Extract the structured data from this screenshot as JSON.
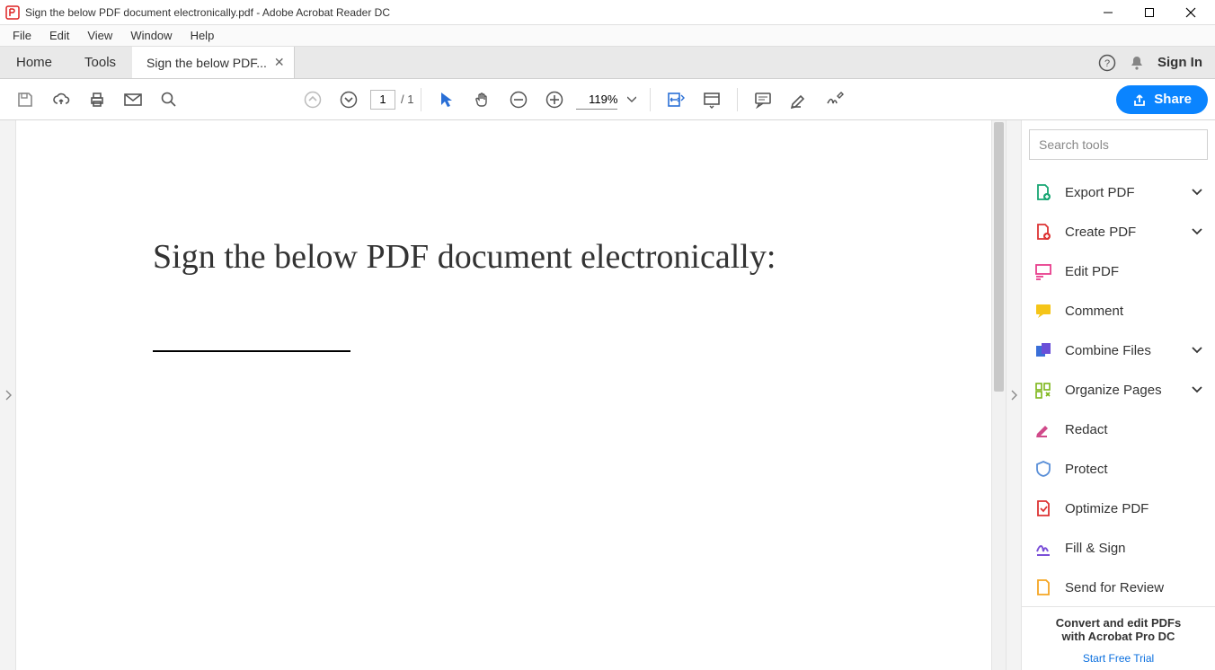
{
  "window": {
    "title": "Sign the below PDF document electronically.pdf - Adobe Acrobat Reader DC"
  },
  "menu": {
    "items": [
      "File",
      "Edit",
      "View",
      "Window",
      "Help"
    ]
  },
  "tabs": {
    "home": "Home",
    "tools": "Tools",
    "doc_label": "Sign the below PDF...",
    "sign_in": "Sign In"
  },
  "toolbar": {
    "page_current": "1",
    "page_total": "/ 1",
    "zoom": "119%",
    "share_label": "Share"
  },
  "document": {
    "heading": "Sign the below PDF document electronically:"
  },
  "right": {
    "search_placeholder": "Search tools",
    "tools": [
      {
        "label": "Export PDF",
        "expandable": true
      },
      {
        "label": "Create PDF",
        "expandable": true
      },
      {
        "label": "Edit PDF",
        "expandable": false
      },
      {
        "label": "Comment",
        "expandable": false
      },
      {
        "label": "Combine Files",
        "expandable": true
      },
      {
        "label": "Organize Pages",
        "expandable": true
      },
      {
        "label": "Redact",
        "expandable": false
      },
      {
        "label": "Protect",
        "expandable": false
      },
      {
        "label": "Optimize PDF",
        "expandable": false
      },
      {
        "label": "Fill & Sign",
        "expandable": false
      },
      {
        "label": "Send for Review",
        "expandable": false
      }
    ],
    "promo_line1": "Convert and edit PDFs",
    "promo_line2": "with Acrobat Pro DC",
    "promo_trial": "Start Free Trial"
  }
}
